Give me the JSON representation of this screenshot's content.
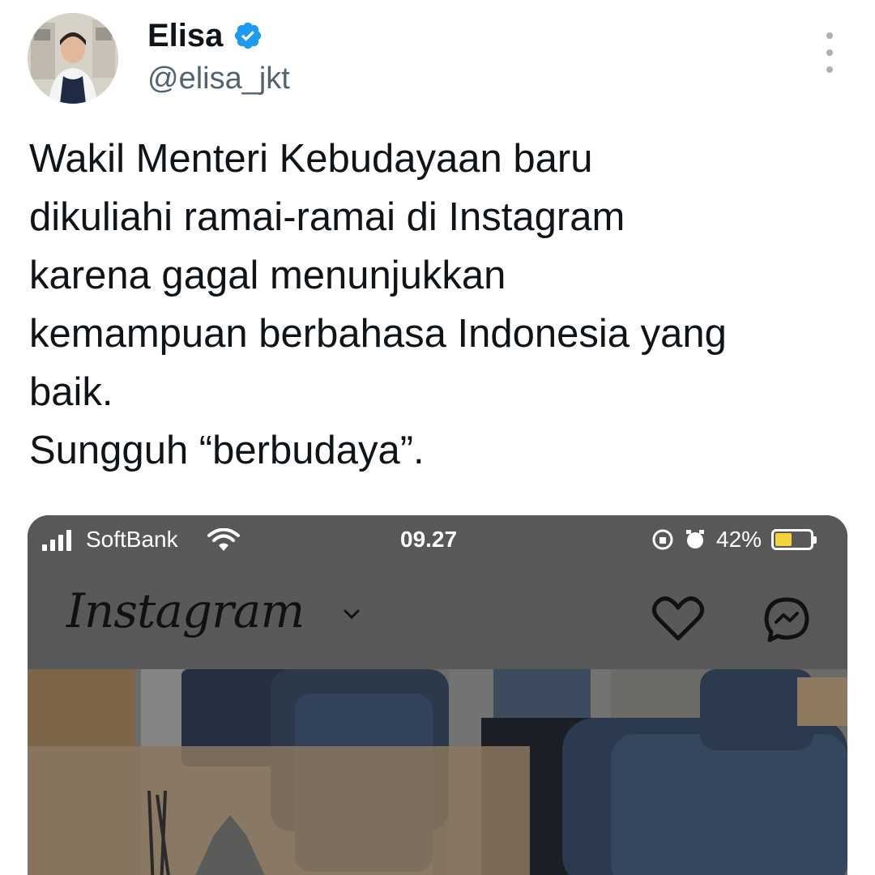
{
  "tweet": {
    "author": {
      "display_name": "Elisa",
      "handle": "@elisa_jkt",
      "verified_icon": "verified-badge-icon",
      "verified_color": "#1d9bf0"
    },
    "text": "Wakil Menteri Kebudayaan baru\ndikuliahi ramai-ramai di Instagram\nkarena gagal menunjukkan\nkemampuan berbahasa Indonesia yang\nbaik.\nSungguh “berbudaya”.",
    "more_icon": "more-vertical-icon"
  },
  "media": {
    "phone_status": {
      "carrier": "SoftBank",
      "time": "09.27",
      "battery": "42%"
    },
    "instagram": {
      "logo": "Instagram",
      "icons": [
        "chevron-down-icon",
        "heart-icon",
        "messenger-icon"
      ]
    }
  }
}
